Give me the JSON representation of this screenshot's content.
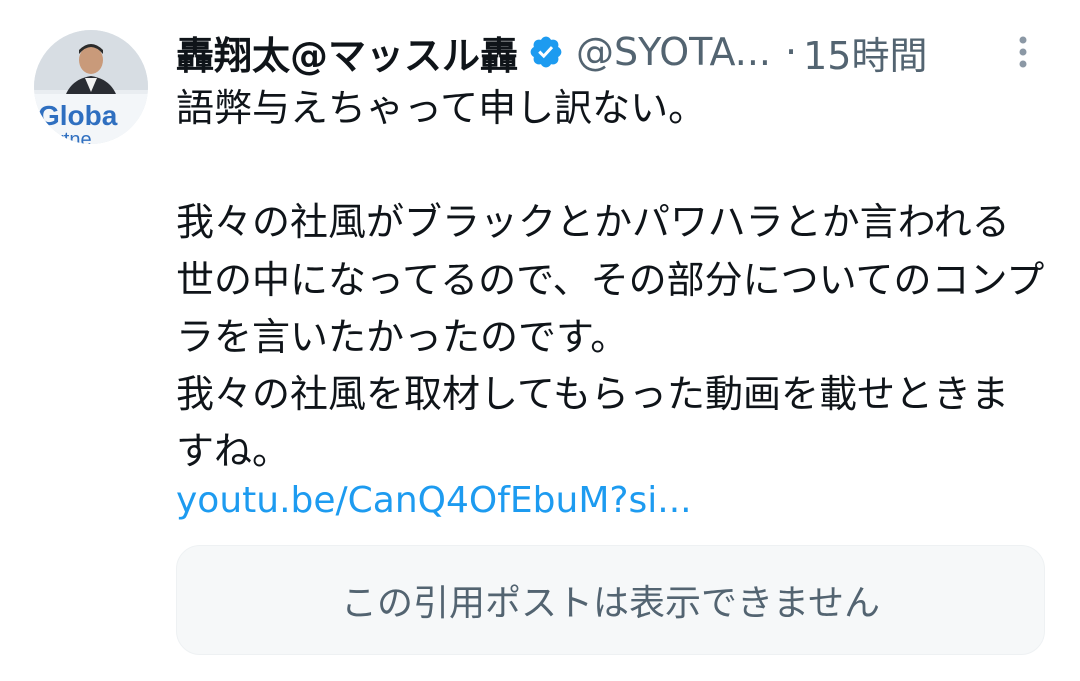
{
  "tweet": {
    "author_name": "轟翔太@マッスル轟",
    "handle": "@SYOTA...",
    "separator": "·",
    "timestamp": "15時間",
    "body": "語弊与えちゃって申し訳ない。\n\n我々の社風がブラックとかパワハラとか言われる世の中になってるので、その部分についてのコンプラを言いたかったのです。\n我々の社風を取材してもらった動画を載せときますね。",
    "link_text": "youtu.be/CanQ4OfEbuM?si...",
    "quote_unavailable": "この引用ポストは表示できません",
    "avatar_text_1": "Globa",
    "avatar_text_2": "artne"
  },
  "icons": {
    "verified": "verified-badge-icon",
    "more": "more-vertical-icon"
  },
  "colors": {
    "text": "#0f1419",
    "secondary": "#536471",
    "link": "#1d9bf0",
    "verified": "#1d9bf0",
    "quote_bg": "#f6f8f9"
  }
}
